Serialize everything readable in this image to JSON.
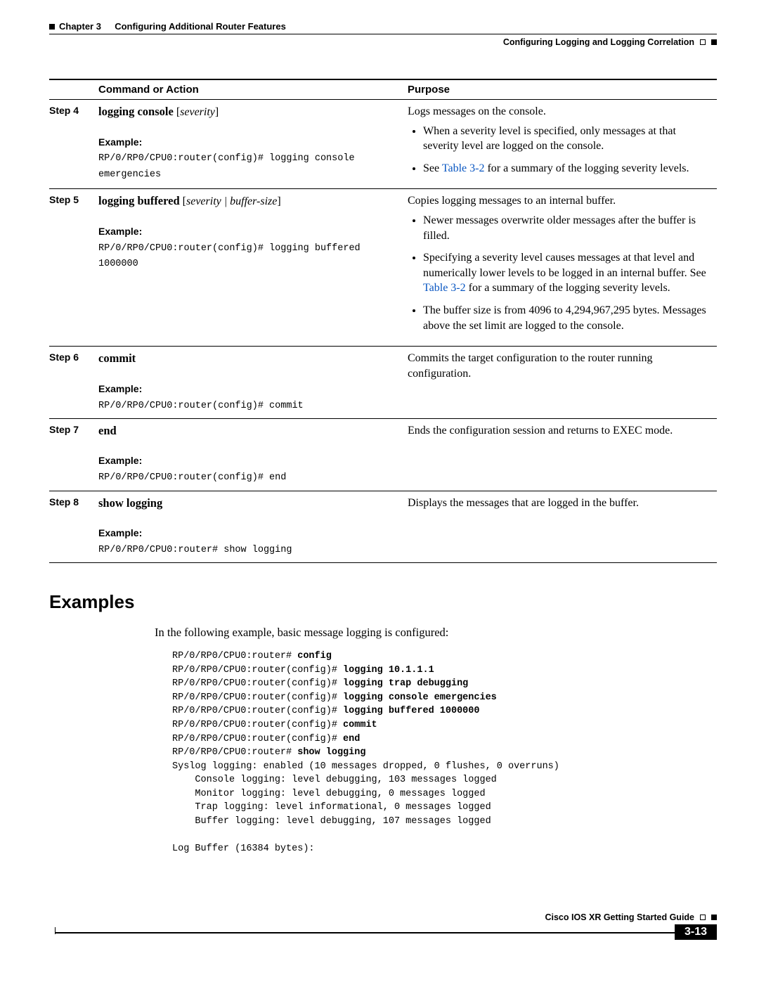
{
  "header": {
    "chapter": "Chapter 3",
    "title": "Configuring Additional Router Features",
    "section": "Configuring Logging and Logging Correlation"
  },
  "table": {
    "headers": {
      "col2": "Command or Action",
      "col3": "Purpose"
    },
    "rows": [
      {
        "step": "Step 4",
        "cmd_bold": "logging console",
        "cmd_italic": "severity",
        "example_label": "Example:",
        "example": "RP/0/RP0/CPU0:router(config)# logging console\nemergencies",
        "purpose_lead": "Logs messages on the console.",
        "bullets": [
          {
            "text": "When a severity level is specified, only messages at that severity level are logged on the console."
          },
          {
            "pre": "See ",
            "link": "Table 3-2",
            "post": " for a summary of the logging severity levels."
          }
        ]
      },
      {
        "step": "Step 5",
        "cmd_bold": "logging buffered",
        "cmd_italic": "severity | buffer-size",
        "example_label": "Example:",
        "example": "RP/0/RP0/CPU0:router(config)# logging buffered 1000000",
        "purpose_lead": "Copies logging messages to an internal buffer.",
        "bullets": [
          {
            "text": "Newer messages overwrite older messages after the buffer is filled."
          },
          {
            "pre": "Specifying a severity level causes messages at that level and numerically lower levels to be logged in an internal buffer. See ",
            "link": "Table 3-2",
            "post": " for a summary of the logging severity levels."
          },
          {
            "text": "The buffer size is from 4096 to 4,294,967,295 bytes. Messages above the set limit are logged to the console."
          }
        ]
      },
      {
        "step": "Step 6",
        "cmd_bold": "commit",
        "cmd_italic": "",
        "example_label": "Example:",
        "example": "RP/0/RP0/CPU0:router(config)# commit",
        "purpose_lead": "Commits the target configuration to the router running configuration.",
        "bullets": []
      },
      {
        "step": "Step 7",
        "cmd_bold": "end",
        "cmd_italic": "",
        "example_label": "Example:",
        "example": "RP/0/RP0/CPU0:router(config)# end",
        "purpose_lead": "Ends the configuration session and returns to EXEC mode.",
        "bullets": []
      },
      {
        "step": "Step 8",
        "cmd_bold": "show logging",
        "cmd_italic": "",
        "example_label": "Example:",
        "example": "RP/0/RP0/CPU0:router# show logging",
        "purpose_lead": "Displays the messages that are logged in the buffer.",
        "bullets": []
      }
    ]
  },
  "examples": {
    "heading": "Examples",
    "intro": "In the following example, basic message logging is configured:",
    "lines": [
      {
        "p": "RP/0/RP0/CPU0:router# ",
        "b": "config"
      },
      {
        "p": "RP/0/RP0/CPU0:router(config)# ",
        "b": "logging 10.1.1.1"
      },
      {
        "p": "RP/0/RP0/CPU0:router(config)# ",
        "b": "logging trap debugging"
      },
      {
        "p": "RP/0/RP0/CPU0:router(config)# ",
        "b": "logging console emergencies"
      },
      {
        "p": "RP/0/RP0/CPU0:router(config)# ",
        "b": "logging buffered 1000000"
      },
      {
        "p": "RP/0/RP0/CPU0:router(config)# ",
        "b": "commit"
      },
      {
        "p": "RP/0/RP0/CPU0:router(config)# ",
        "b": "end"
      },
      {
        "p": "RP/0/RP0/CPU0:router# ",
        "b": "show logging"
      },
      {
        "p": "Syslog logging: enabled (10 messages dropped, 0 flushes, 0 overruns)",
        "b": ""
      },
      {
        "p": "    Console logging: level debugging, 103 messages logged",
        "b": ""
      },
      {
        "p": "    Monitor logging: level debugging, 0 messages logged",
        "b": ""
      },
      {
        "p": "    Trap logging: level informational, 0 messages logged",
        "b": ""
      },
      {
        "p": "    Buffer logging: level debugging, 107 messages logged",
        "b": ""
      },
      {
        "p": "",
        "b": ""
      },
      {
        "p": "Log Buffer (16384 bytes):",
        "b": ""
      }
    ]
  },
  "footer": {
    "guide": "Cisco IOS XR Getting Started Guide",
    "page": "3-13"
  }
}
